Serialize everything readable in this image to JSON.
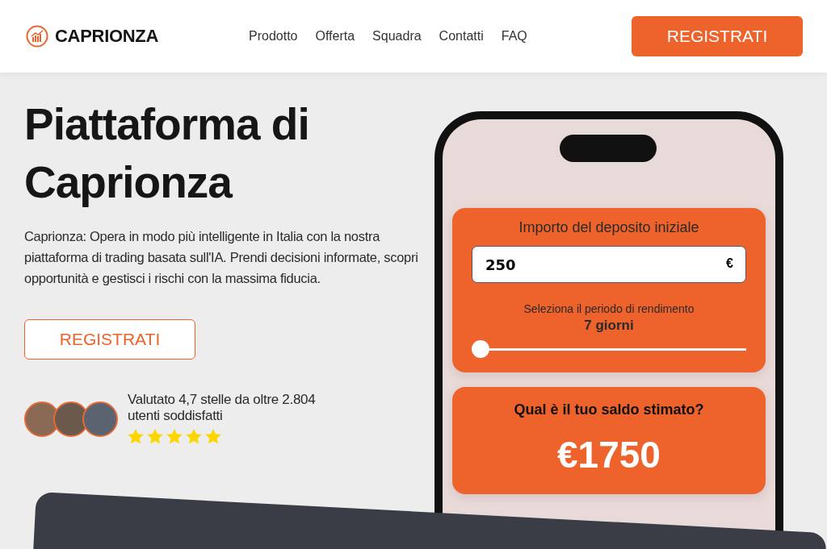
{
  "header": {
    "brand": "CAPRIONZA",
    "nav": [
      {
        "label": "Prodotto"
      },
      {
        "label": "Offerta"
      },
      {
        "label": "Squadra"
      },
      {
        "label": "Contatti"
      },
      {
        "label": "FAQ"
      }
    ],
    "cta": "REGISTRATI"
  },
  "hero": {
    "title": "Piattaforma di Caprionza",
    "description": "Caprionza: Opera in modo più intelligente in Italia con la nostra piattaforma di trading basata sull'IA. Prendi decisioni informate, scopri opportunità e gestisci i rischi con la massima fiducia.",
    "button": "REGISTRATI",
    "rating": {
      "text": "Valutato 4,7 stelle da oltre 2.804 utenti soddisfatti",
      "stars": 5
    }
  },
  "calculator": {
    "deposit_label": "Importo del deposito iniziale",
    "deposit_value": "250",
    "currency": "€",
    "period_label": "Seleziona il periodo di rendimento",
    "period_value": "7 giorni",
    "period": {
      "level": 0
    },
    "result_label": "Qual è il tuo saldo stimato?",
    "result_value": "€1750"
  }
}
